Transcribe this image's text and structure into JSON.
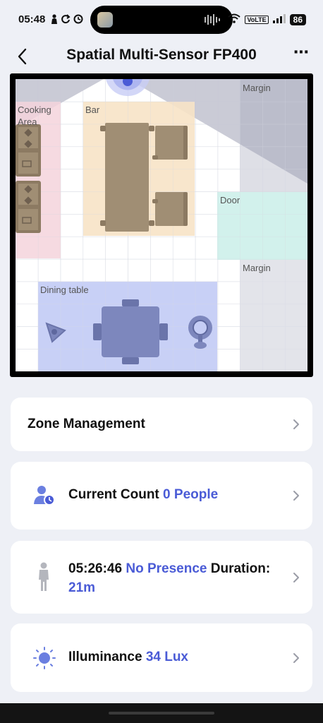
{
  "status_bar": {
    "time": "05:48",
    "battery": "86",
    "network": "VoLTE"
  },
  "header": {
    "title": "Spatial Multi-Sensor FP400"
  },
  "map": {
    "zones": {
      "cooking": "Cooking Area",
      "bar": "Bar",
      "margin_top": "Margin",
      "door": "Door",
      "margin_right": "Margin",
      "dining": "Dining table"
    },
    "colors": {
      "cooking": "#f5d3dc",
      "bar": "#f7e3c6",
      "door": "#cdf0ea",
      "dining": "#c5cdf5",
      "margin": "#e4e5ec",
      "furniture": "#a08e74",
      "furniture_dark": "#8c7a62",
      "dining_furniture": "#7d87bd"
    }
  },
  "cards": {
    "zone_management": "Zone Management",
    "count": {
      "label": "Current Count",
      "value": "0 People"
    },
    "presence": {
      "time": "05:26:46",
      "status": "No Presence",
      "duration_label": "Duration:",
      "duration": "21m"
    },
    "illuminance": {
      "label": "Illuminance",
      "value": "34 Lux"
    }
  },
  "accent_color": "#4a5bd6"
}
